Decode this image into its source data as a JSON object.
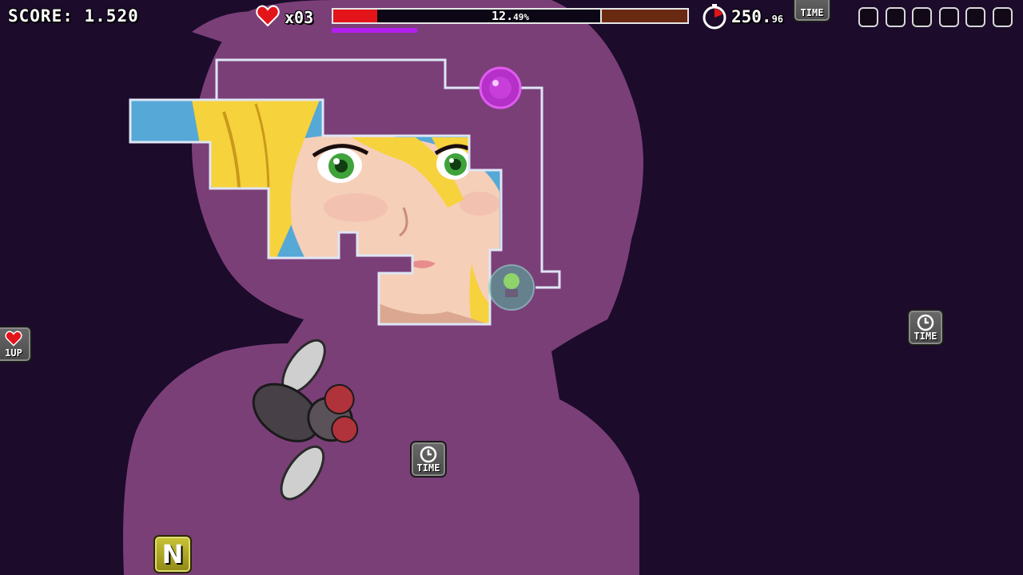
{
  "hud": {
    "score_label": "SCORE:",
    "score_value": "1.520",
    "lives": "x03",
    "progress_percent": 12.49,
    "progress_main": "12.",
    "progress_small": "49%",
    "sub_bar_fraction": 0.24,
    "timer_main": "250.",
    "timer_small": "96",
    "inventory_slots": 6
  },
  "pickups": {
    "time_label": "TIME",
    "oneup_label": "1UP",
    "n_label": "N"
  },
  "colors": {
    "background": "#1c0b2b",
    "silhouette": "#7b3f78",
    "progress_fill": "#e3141a",
    "progress_goal": "#6a2a12",
    "sub_bar": "#b41ff0"
  }
}
